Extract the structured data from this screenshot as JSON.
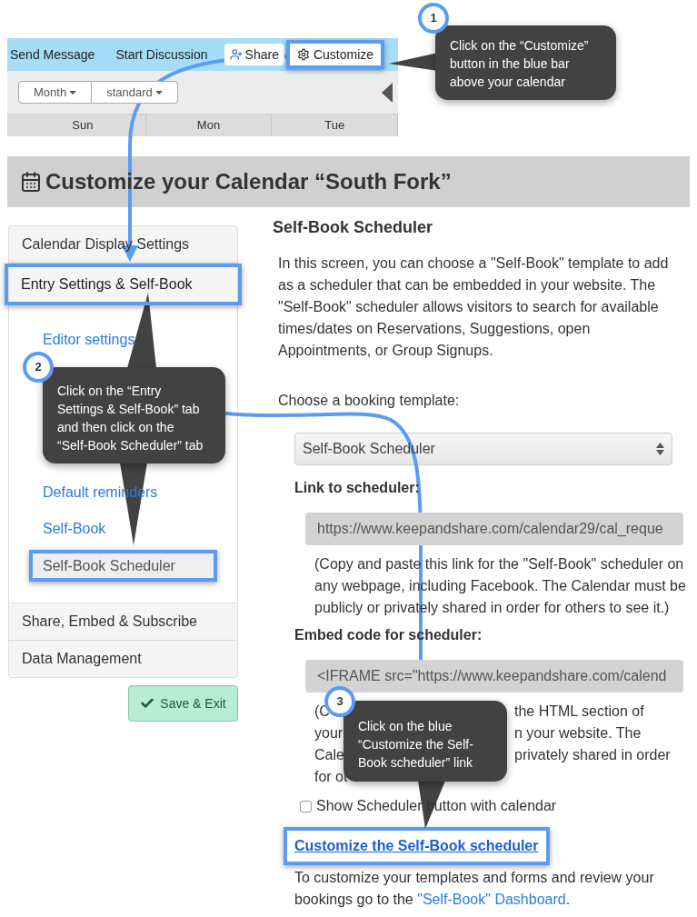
{
  "calendar_toolbar": {
    "links": [
      "Send Message",
      "Start Discussion"
    ],
    "share_button": "Share",
    "customize_button": {
      "label": "Customize",
      "highlighted": true
    },
    "view_dropdowns": [
      "Month",
      "standard"
    ],
    "day_headers": [
      "Sun",
      "Mon",
      "Tue"
    ]
  },
  "page_title": "Customize your Calendar “South Fork”",
  "sidebar": {
    "items": [
      {
        "label": "Calendar Display Settings",
        "expanded": false,
        "highlighted": false
      },
      {
        "label": "Entry Settings & Self-Book",
        "expanded": true,
        "highlighted": true,
        "children": [
          {
            "label": "Editor settings",
            "selected": false,
            "highlighted": false
          },
          {
            "label": "Default reminders",
            "selected": false,
            "highlighted": false
          },
          {
            "label": "Self-Book",
            "selected": false,
            "highlighted": false
          },
          {
            "label": "Self-Book Scheduler",
            "selected": true,
            "highlighted": true
          }
        ]
      },
      {
        "label": "Share, Embed & Subscribe",
        "expanded": false,
        "highlighted": false
      },
      {
        "label": "Data Management",
        "expanded": false,
        "highlighted": false
      }
    ]
  },
  "save_button": "Save & Exit",
  "content": {
    "heading": "Self-Book Scheduler",
    "intro": "In this screen, you can choose a \"Self-Book\" template to add as a scheduler that can be embedded in your website. The \"Self-Book\" scheduler allows visitors to search for available times/dates on Reservations, Suggestions, open Appointments, or Group Signups.",
    "template_label": "Choose a booking template:",
    "template_select": "Self-Book Scheduler",
    "link_label": "Link to scheduler:",
    "link_value": "https://www.keepandshare.com/calendar29/cal_reque",
    "link_note": "(Copy and paste this link for the \"Self-Book\" scheduler on any webpage, including Facebook. The Calendar must be publicly or privately shared in order for others to see it.)",
    "embed_label": "Embed code for scheduler:",
    "embed_value": "<IFRAME src=\"https://www.keepandshare.com/calend",
    "embed_note_lines": [
      [
        "(C",
        "the HTML section of"
      ],
      [
        "your",
        "n your website. The"
      ],
      [
        "Cale",
        "privately shared in order"
      ],
      [
        "for ot"
      ]
    ],
    "show_button_checkbox": {
      "label": "Show Scheduler button with calendar",
      "checked": false
    },
    "customize_link": {
      "label": "Customize the Self-Book scheduler",
      "highlighted": true
    },
    "footer_text": "To customize your templates and forms and review your bookings go to the ",
    "dashboard_link": "\"Self-Book\" Dashboard",
    "footer_end": "."
  },
  "callouts": [
    {
      "number": "1",
      "text": "Click on the “Customize” button in the blue bar above your calendar"
    },
    {
      "number": "2",
      "text": "Click on the “Entry Settings & Self-Book” tab and then click on the “Self-Book Scheduler” tab"
    },
    {
      "number": "3",
      "text": "Click on the blue “Customize the Self-Book scheduler” link"
    }
  ]
}
